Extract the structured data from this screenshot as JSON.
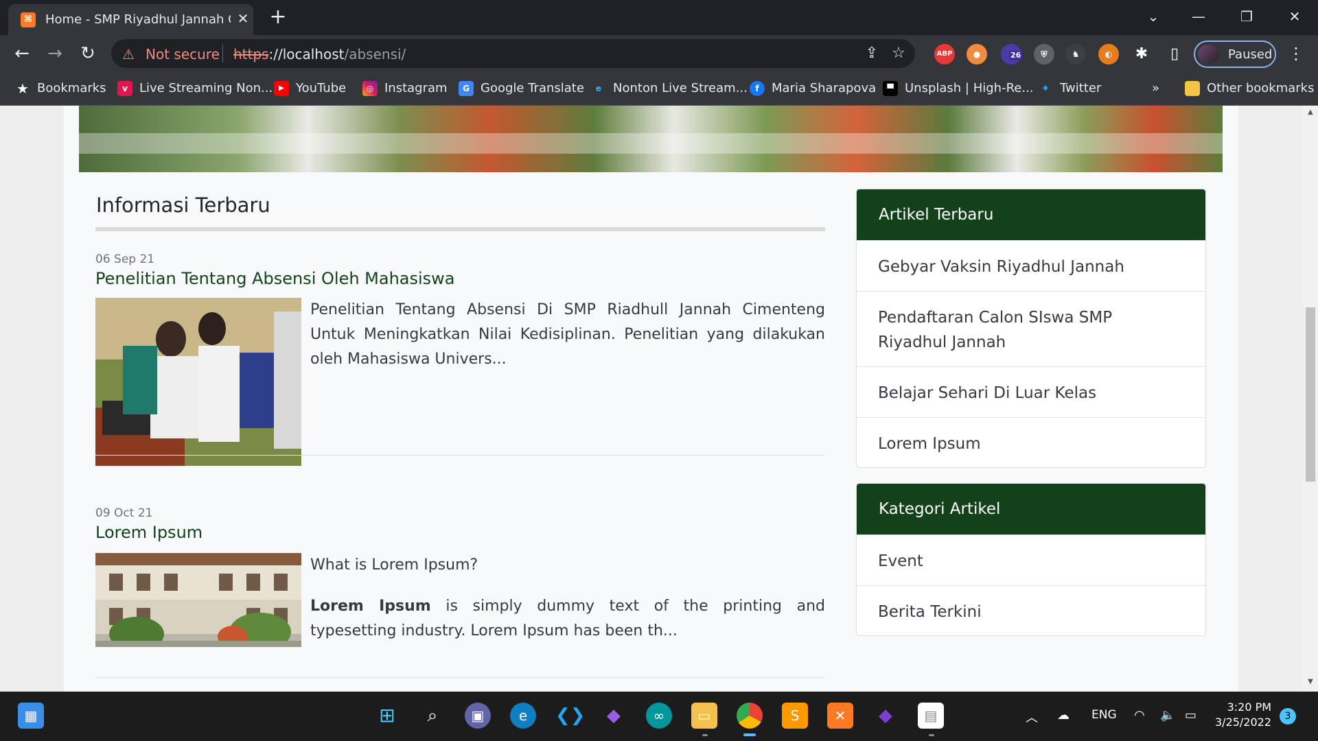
{
  "browser": {
    "tab_title": "Home - SMP Riyadhul Jannah Cimenteng",
    "tab_favicon": "xampp-icon",
    "security_label": "Not secure",
    "url_scheme": "https",
    "url_host": "://localhost",
    "url_path": "/absensi/",
    "profile_label": "Paused",
    "extension_badge": "26",
    "abp_label": "ABP",
    "bookmarks_overflow": "»",
    "bookmarks": [
      {
        "label": "Bookmarks",
        "icon": "star-icon"
      },
      {
        "label": "Live Streaming Non...",
        "icon": "vidio-icon"
      },
      {
        "label": "YouTube",
        "icon": "youtube-icon"
      },
      {
        "label": "Instagram",
        "icon": "instagram-icon"
      },
      {
        "label": "Google Translate",
        "icon": "google-translate-icon"
      },
      {
        "label": "Nonton Live Stream...",
        "icon": "stream-icon"
      },
      {
        "label": "Maria Sharapova",
        "icon": "facebook-icon"
      },
      {
        "label": "Unsplash | High-Re...",
        "icon": "unsplash-icon"
      },
      {
        "label": "Twitter",
        "icon": "twitter-icon"
      },
      {
        "label": "Other bookmarks",
        "icon": "folder-icon"
      }
    ]
  },
  "page": {
    "section_title": "Informasi Terbaru",
    "posts": [
      {
        "date": "06 Sep 21",
        "title": "Penelitian Tentang Absensi Oleh Mahasiswa",
        "excerpt": "Penelitian Tentang Absensi Di SMP Riadhull Jannah Cimenteng Untuk Meningkatkan Nilai Kedisiplinan. Penelitian yang dilakukan oleh Mahasiswa Univers..."
      },
      {
        "date": "09 Oct 21",
        "title": "Lorem Ipsum",
        "excerpt_question": "What is Lorem Ipsum?",
        "excerpt_bold": "Lorem Ipsum",
        "excerpt_rest": " is simply dummy text of the printing and typesetting industry. Lorem Ipsum has been th..."
      }
    ],
    "sidebar": {
      "recent": {
        "header": "Artikel Terbaru",
        "items": [
          "Gebyar Vaksin Riyadhul Jannah",
          "Pendaftaran Calon SIswa SMP Riyadhul Jannah",
          "Belajar Sehari Di Luar Kelas",
          "Lorem Ipsum"
        ]
      },
      "categories": {
        "header": "Kategori Artikel",
        "items": [
          "Event",
          "Berita Terkini"
        ]
      }
    }
  },
  "taskbar": {
    "language": "ENG",
    "time": "3:20 PM",
    "date": "3/25/2022",
    "notifications": "3"
  },
  "colors": {
    "accent_green": "#13421a",
    "title_green": "#13431c",
    "security_warning": "#f28b82",
    "windows_accent": "#4cc2ff"
  }
}
